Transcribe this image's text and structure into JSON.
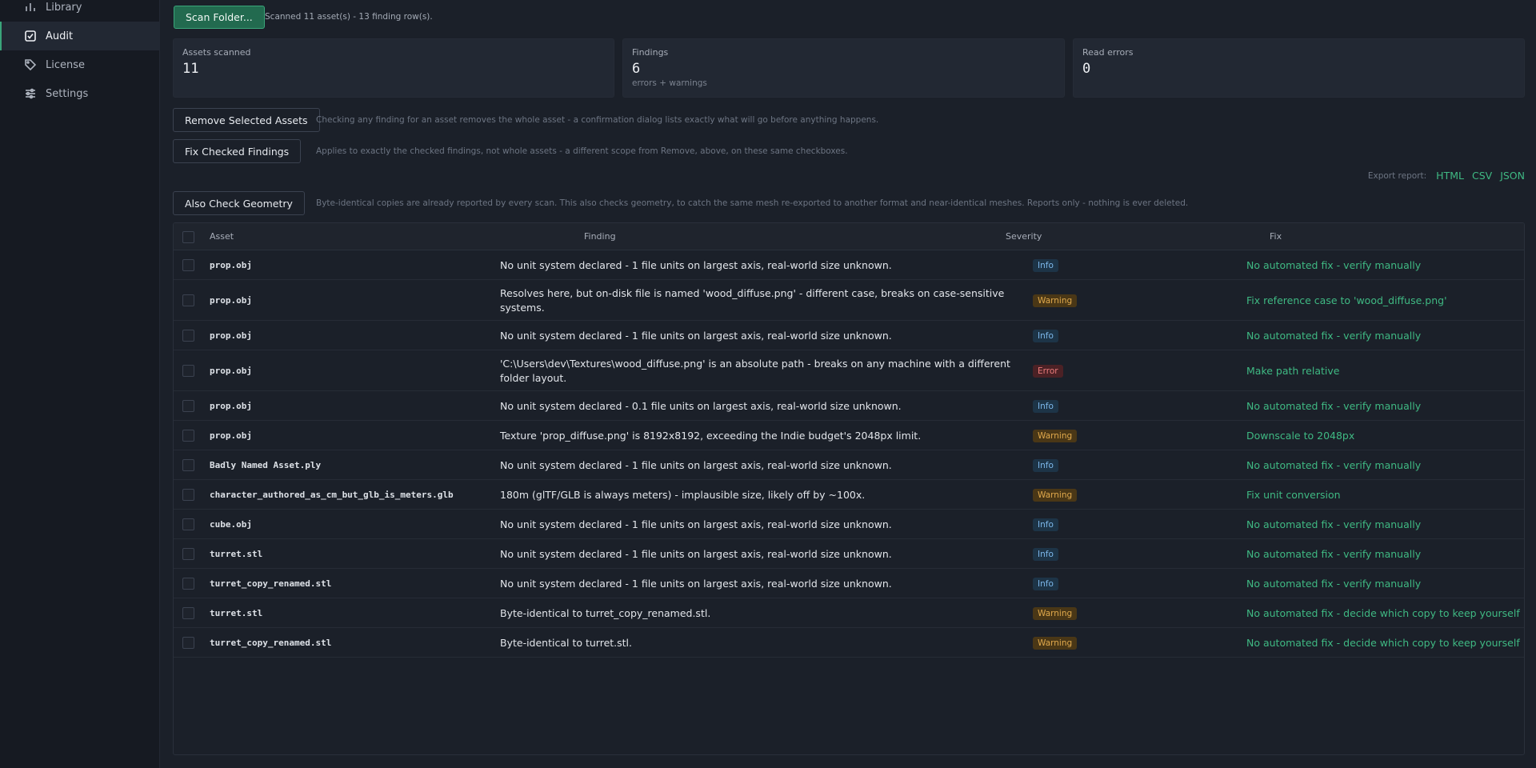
{
  "sidebar": {
    "items": [
      {
        "label": "Library",
        "icon": "bar-chart-icon"
      },
      {
        "label": "Audit",
        "icon": "checkbox-icon"
      },
      {
        "label": "License",
        "icon": "tag-icon"
      },
      {
        "label": "Settings",
        "icon": "sliders-icon"
      }
    ],
    "active": "Audit"
  },
  "toolbar": {
    "scan_label": "Scan Folder...",
    "scan_status": "Scanned 11 asset(s) - 13 finding row(s)."
  },
  "stats": [
    {
      "label": "Assets scanned",
      "value": "11",
      "sub": ""
    },
    {
      "label": "Findings",
      "value": "6",
      "sub": "errors + warnings"
    },
    {
      "label": "Read errors",
      "value": "0",
      "sub": ""
    }
  ],
  "actions": {
    "remove_label": "Remove Selected Assets",
    "remove_note": "Checking any finding for an asset removes the whole asset - a confirmation dialog lists exactly what will go before anything happens.",
    "fix_label": "Fix Checked Findings",
    "fix_note": "Applies to exactly the checked findings, not whole assets - a different scope from Remove, above, on these same checkboxes.",
    "geometry_label": "Also Check Geometry",
    "geometry_note": "Byte-identical copies are already reported by every scan. This also checks geometry, to catch the same mesh re-exported to another format and near-identical meshes. Reports only - nothing is ever deleted."
  },
  "export": {
    "label": "Export report:",
    "links": [
      "HTML",
      "CSV",
      "JSON"
    ]
  },
  "table": {
    "columns": [
      "Asset",
      "Finding",
      "Severity",
      "Fix"
    ],
    "rows": [
      {
        "asset": "prop.obj",
        "finding": "No unit system declared - 1 file units on largest axis, real-world size unknown.",
        "severity": "Info",
        "fix": "No automated fix - verify manually"
      },
      {
        "asset": "prop.obj",
        "finding": "Resolves here, but on-disk file is named 'wood_diffuse.png' - different case, breaks on case-sensitive systems.",
        "severity": "Warning",
        "fix": "Fix reference case to 'wood_diffuse.png'"
      },
      {
        "asset": "prop.obj",
        "finding": "No unit system declared - 1 file units on largest axis, real-world size unknown.",
        "severity": "Info",
        "fix": "No automated fix - verify manually"
      },
      {
        "asset": "prop.obj",
        "finding": "'C:\\Users\\dev\\Textures\\wood_diffuse.png' is an absolute path - breaks on any machine with a different folder layout.",
        "severity": "Error",
        "fix": "Make path relative"
      },
      {
        "asset": "prop.obj",
        "finding": "No unit system declared - 0.1 file units on largest axis, real-world size unknown.",
        "severity": "Info",
        "fix": "No automated fix - verify manually"
      },
      {
        "asset": "prop.obj",
        "finding": "Texture 'prop_diffuse.png' is 8192x8192, exceeding the Indie budget's 2048px limit.",
        "severity": "Warning",
        "fix": "Downscale to 2048px"
      },
      {
        "asset": "Badly Named Asset.ply",
        "finding": "No unit system declared - 1 file units on largest axis, real-world size unknown.",
        "severity": "Info",
        "fix": "No automated fix - verify manually"
      },
      {
        "asset": "character_authored_as_cm_but_glb_is_meters.glb",
        "finding": "180m (glTF/GLB is always meters) - implausible size, likely off by ~100x.",
        "severity": "Warning",
        "fix": "Fix unit conversion"
      },
      {
        "asset": "cube.obj",
        "finding": "No unit system declared - 1 file units on largest axis, real-world size unknown.",
        "severity": "Info",
        "fix": "No automated fix - verify manually"
      },
      {
        "asset": "turret.stl",
        "finding": "No unit system declared - 1 file units on largest axis, real-world size unknown.",
        "severity": "Info",
        "fix": "No automated fix - verify manually"
      },
      {
        "asset": "turret_copy_renamed.stl",
        "finding": "No unit system declared - 1 file units on largest axis, real-world size unknown.",
        "severity": "Info",
        "fix": "No automated fix - verify manually"
      },
      {
        "asset": "turret.stl",
        "finding": "Byte-identical to turret_copy_renamed.stl.",
        "severity": "Warning",
        "fix": "No automated fix - decide which copy to keep yourself"
      },
      {
        "asset": "turret_copy_renamed.stl",
        "finding": "Byte-identical to turret.stl.",
        "severity": "Warning",
        "fix": "No automated fix - decide which copy to keep yourself"
      }
    ]
  },
  "colors": {
    "accent": "#3aa57a",
    "link": "#3fb983",
    "info": "#7cb7ea",
    "warning": "#e0a94c",
    "error": "#ea7b7b"
  }
}
